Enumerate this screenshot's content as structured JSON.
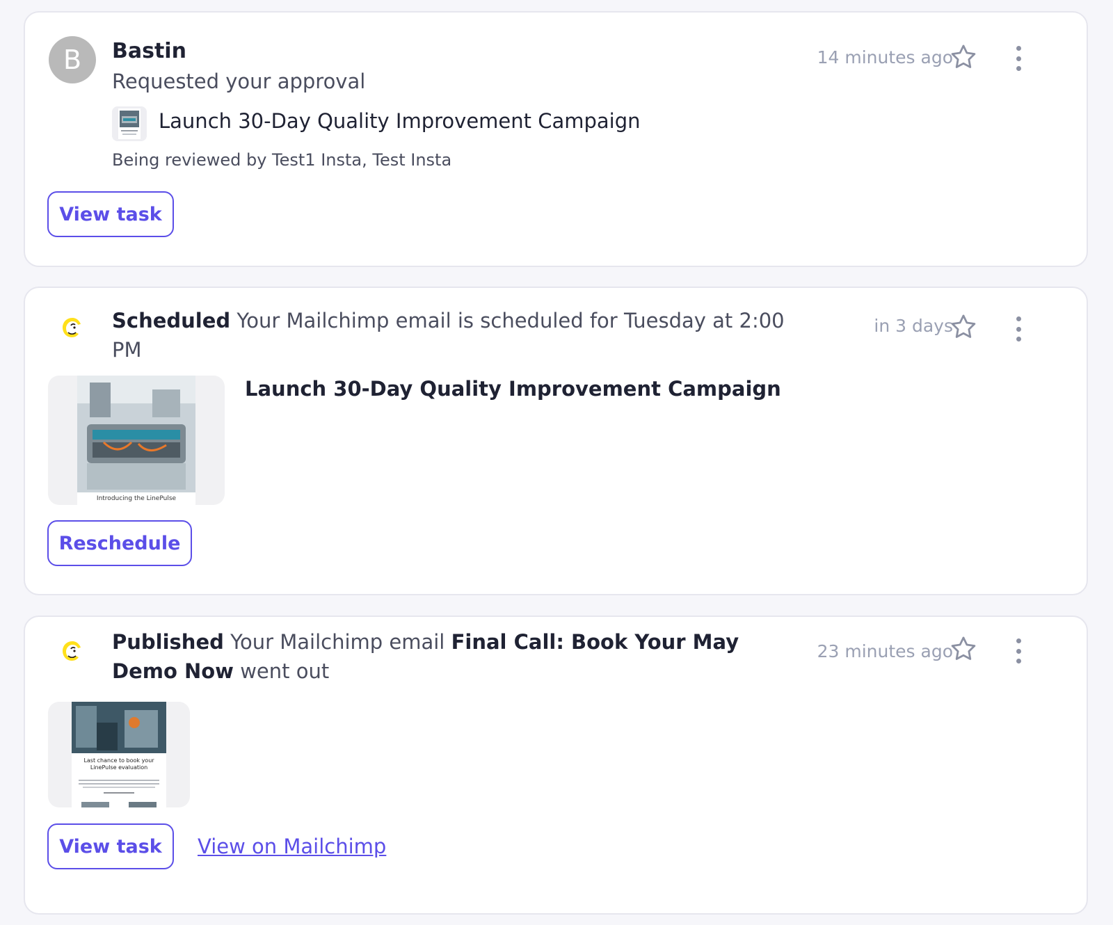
{
  "notifications": [
    {
      "avatar_letter": "B",
      "name": "Bastin",
      "subtitle": "Requested your approval",
      "task_title": "Launch 30-Day Quality Improvement Campaign",
      "reviewers": "Being reviewed by Test1 Insta, Test Insta",
      "time": "14 minutes ago",
      "button_label": "View task"
    },
    {
      "status": "Scheduled",
      "message": "Your Mailchimp email is scheduled for Tuesday at 2:00 PM",
      "time": "in 3 days",
      "preview_caption": "Introducing the LinePulse",
      "campaign_title": "Launch 30-Day Quality Improvement Campaign",
      "button_label": "Reschedule"
    },
    {
      "status": "Published",
      "message_prefix": "Your Mailchimp email",
      "email_name": "Final Call: Book Your May Demo Now",
      "message_suffix": "went out",
      "time": "23 minutes ago",
      "preview_caption": "Last chance to book your LinePulse evaluation",
      "button_label": "View task",
      "link_label": "View on Mailchimp"
    }
  ],
  "icons": {
    "app": "mailchimp-icon",
    "star": "star-outline-icon",
    "more": "kebab-menu-icon"
  },
  "colors": {
    "accent": "#5b4ee8",
    "muted_text": "#9aa0b3",
    "avatar_bg": "#b9b9b9",
    "mailchimp_yellow": "#ffe01b"
  }
}
